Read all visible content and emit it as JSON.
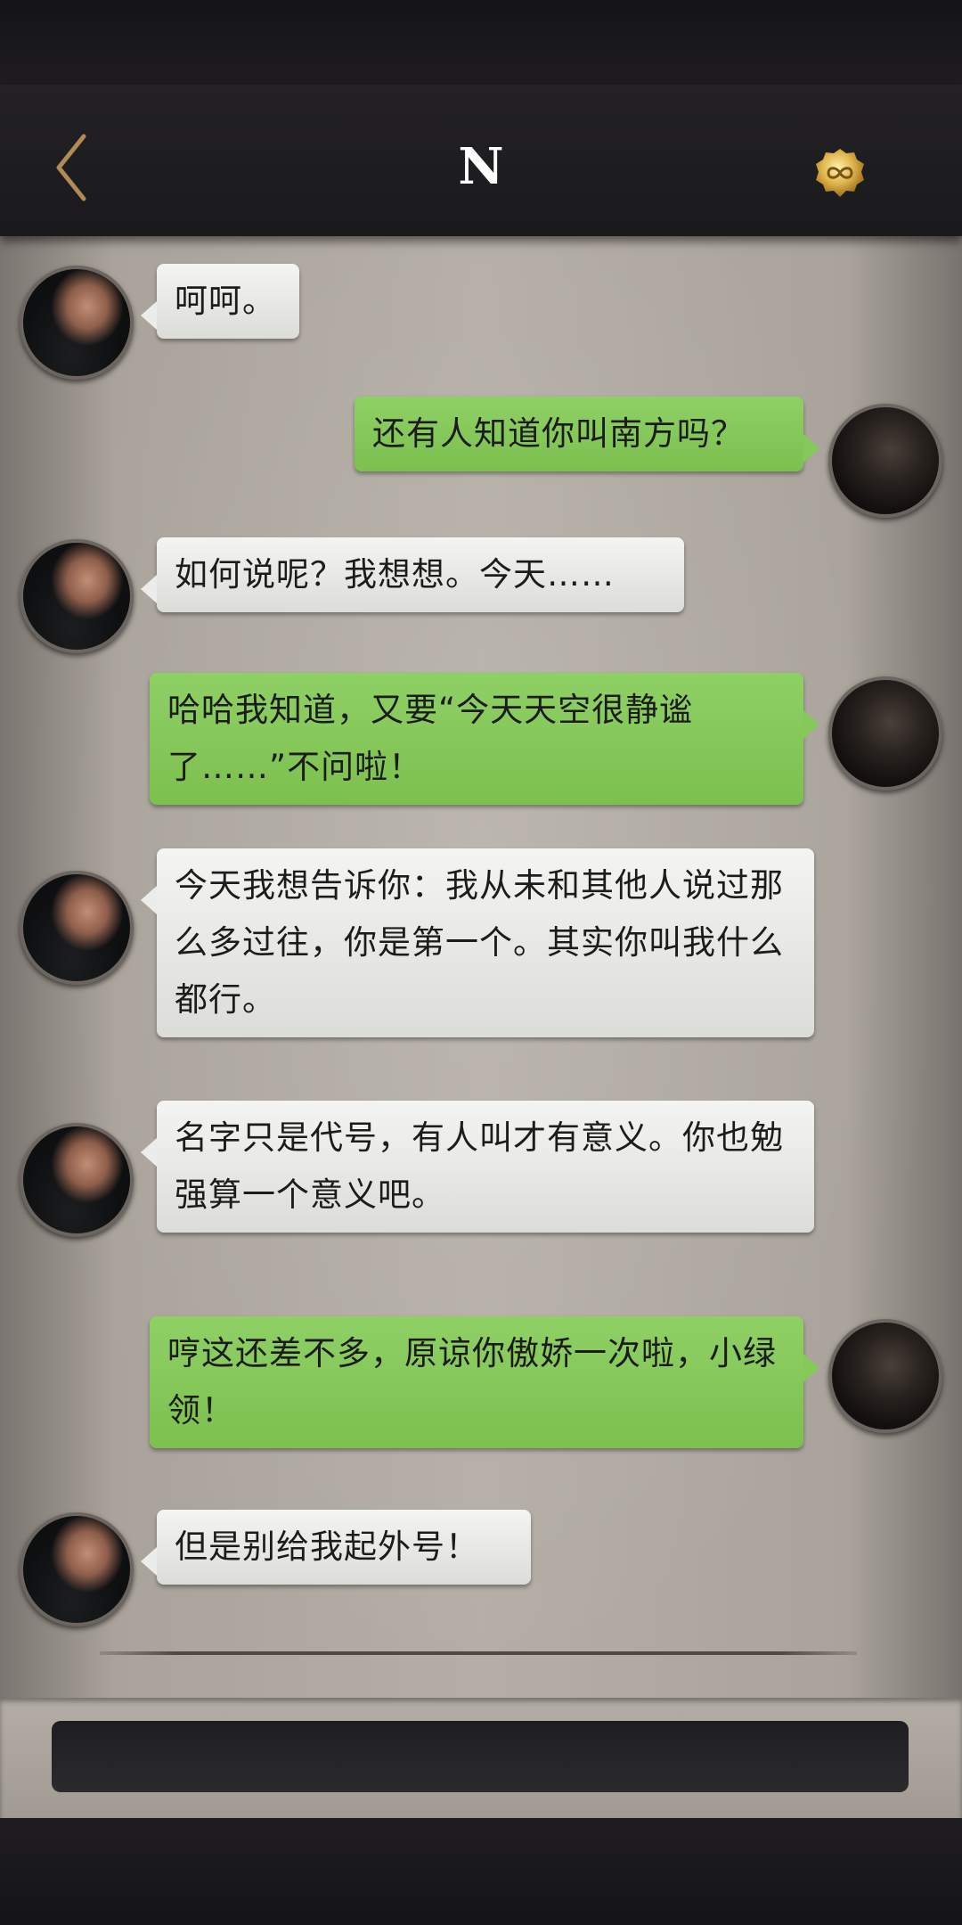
{
  "header": {
    "title": "N",
    "back_icon": "chevron-left-icon",
    "badge_icon": "infinity-coin-icon",
    "accent": "#b28a55"
  },
  "messages": [
    {
      "from": "them",
      "text": "呵呵。"
    },
    {
      "from": "me",
      "text": "还有人知道你叫南方吗？"
    },
    {
      "from": "them",
      "text": "如何说呢？我想想。今天……"
    },
    {
      "from": "me",
      "text": "哈哈我知道，又要“今天天空很静谧了……”不问啦！"
    },
    {
      "from": "them",
      "text": "今天我想告诉你：我从未和其他人说过那么多过往，你是第一个。其实你叫我什么都行。"
    },
    {
      "from": "them",
      "text": "名字只是代号，有人叫才有意义。你也勉强算一个意义吧。"
    },
    {
      "from": "me",
      "text": "哼这还差不多，原谅你傲娇一次啦，小绿领！"
    },
    {
      "from": "them",
      "text": "但是别给我起外号！"
    }
  ],
  "input": {
    "placeholder": "",
    "value": ""
  },
  "colors": {
    "my_bubble": "#86c85a",
    "their_bubble": "#ececea",
    "bar": "#1b1a1c"
  }
}
